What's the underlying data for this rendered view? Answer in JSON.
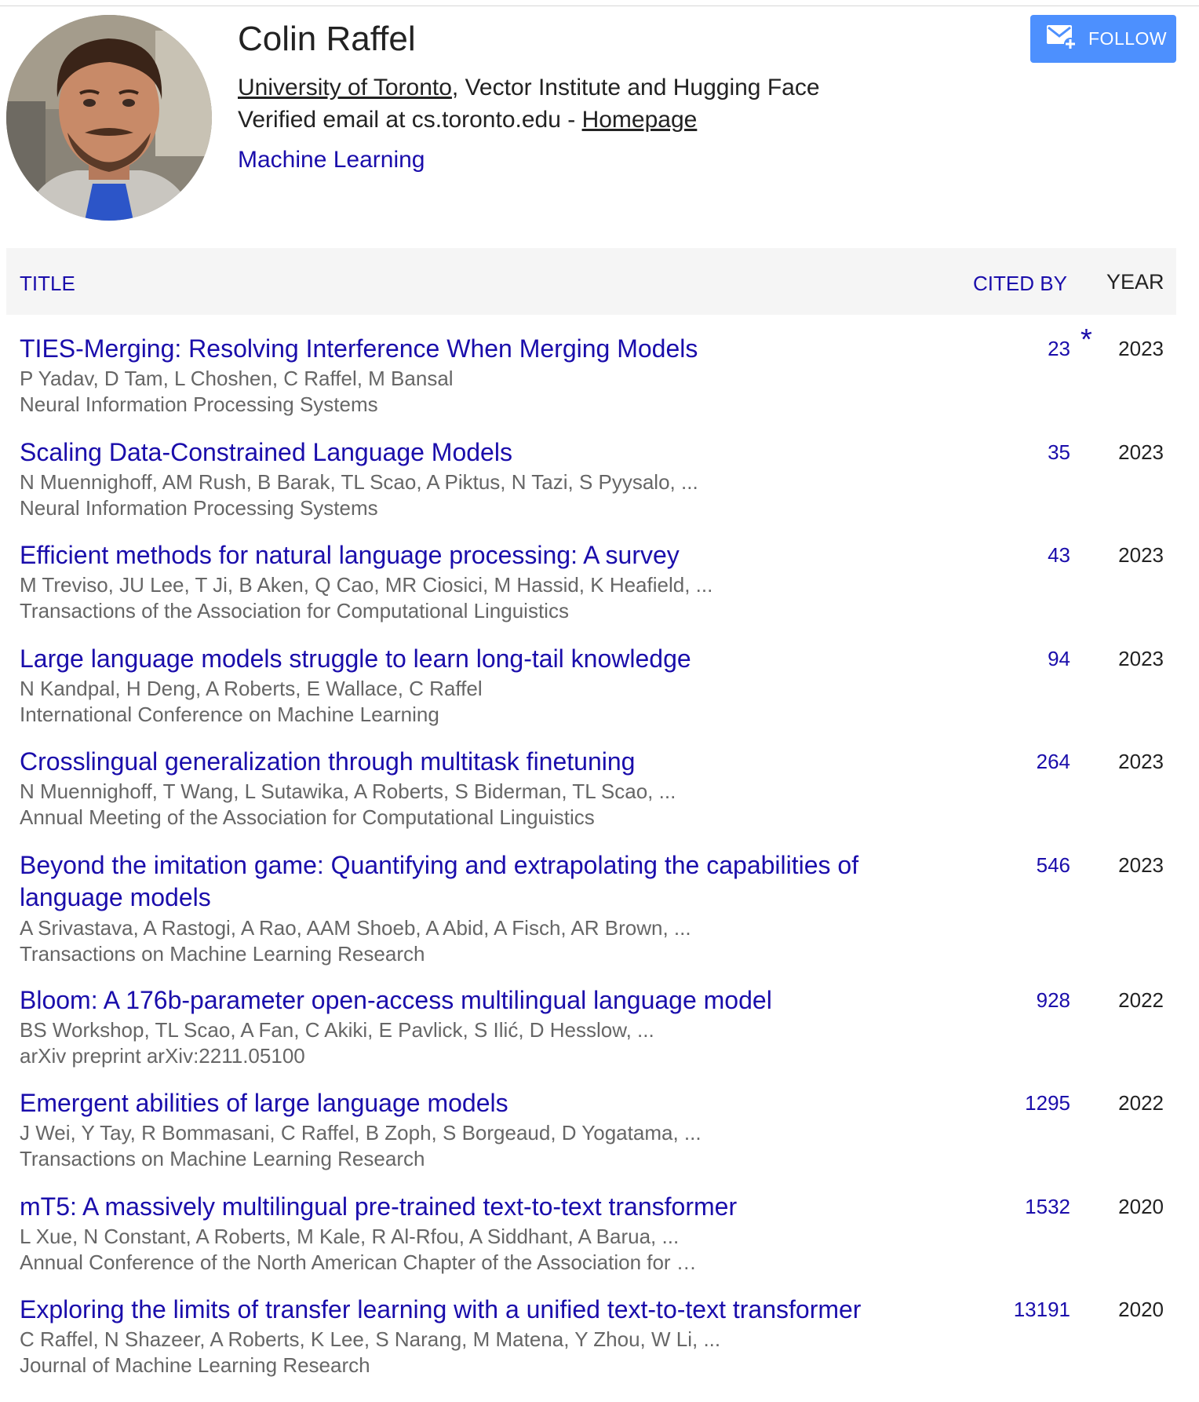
{
  "profile": {
    "name": "Colin Raffel",
    "affiliation_link": "University of Toronto",
    "affiliation_rest": ", Vector Institute and Hugging Face",
    "email_prefix": "Verified email at cs.toronto.edu - ",
    "homepage_label": "Homepage",
    "interest": "Machine Learning",
    "follow_label": "FOLLOW"
  },
  "table": {
    "col_title": "TITLE",
    "col_cited": "CITED BY",
    "col_year": "YEAR"
  },
  "publications": [
    {
      "title": "TIES-Merging: Resolving Interference When Merging Models",
      "authors": "P Yadav, D Tam, L Choshen, C Raffel, M Bansal",
      "venue": "Neural Information Processing Systems",
      "cited_by": "23",
      "star": "*",
      "year": "2023"
    },
    {
      "title": "Scaling Data-Constrained Language Models",
      "authors": "N Muennighoff, AM Rush, B Barak, TL Scao, A Piktus, N Tazi, S Pyysalo, ...",
      "venue": "Neural Information Processing Systems",
      "cited_by": "35",
      "year": "2023"
    },
    {
      "title": "Efficient methods for natural language processing: A survey",
      "authors": "M Treviso, JU Lee, T Ji, B Aken, Q Cao, MR Ciosici, M Hassid, K Heafield, ...",
      "venue": "Transactions of the Association for Computational Linguistics",
      "cited_by": "43",
      "year": "2023"
    },
    {
      "title": "Large language models struggle to learn long-tail knowledge",
      "authors": "N Kandpal, H Deng, A Roberts, E Wallace, C Raffel",
      "venue": "International Conference on Machine Learning",
      "cited_by": "94",
      "year": "2023"
    },
    {
      "title": "Crosslingual generalization through multitask finetuning",
      "authors": "N Muennighoff, T Wang, L Sutawika, A Roberts, S Biderman, TL Scao, ...",
      "venue": "Annual Meeting of the Association for Computational Linguistics",
      "cited_by": "264",
      "year": "2023"
    },
    {
      "title": "Beyond the imitation game: Quantifying and extrapolating the capabilities of language models",
      "authors": "A Srivastava, A Rastogi, A Rao, AAM Shoeb, A Abid, A Fisch, AR Brown, ...",
      "venue": "Transactions on Machine Learning Research",
      "cited_by": "546",
      "year": "2023"
    },
    {
      "title": "Bloom: A 176b-parameter open-access multilingual language model",
      "authors": "BS Workshop, TL Scao, A Fan, C Akiki, E Pavlick, S Ilić, D Hesslow, ...",
      "venue": "arXiv preprint arXiv:2211.05100",
      "cited_by": "928",
      "year": "2022"
    },
    {
      "title": "Emergent abilities of large language models",
      "authors": "J Wei, Y Tay, R Bommasani, C Raffel, B Zoph, S Borgeaud, D Yogatama, ...",
      "venue": "Transactions on Machine Learning Research",
      "cited_by": "1295",
      "year": "2022"
    },
    {
      "title": "mT5: A massively multilingual pre-trained text-to-text transformer",
      "authors": "L Xue, N Constant, A Roberts, M Kale, R Al-Rfou, A Siddhant, A Barua, ...",
      "venue": "Annual Conference of the North American Chapter of the Association for …",
      "cited_by": "1532",
      "year": "2020"
    },
    {
      "title": "Exploring the limits of transfer learning with a unified text-to-text transformer",
      "authors": "C Raffel, N Shazeer, A Roberts, K Lee, S Narang, M Matena, Y Zhou, W Li, ...",
      "venue": "Journal of Machine Learning Research",
      "cited_by": "13191",
      "year": "2020"
    }
  ],
  "colors": {
    "link": "#1a0dab",
    "meta": "#666666",
    "follow_button": "#4d90fe",
    "header_bg": "#f5f5f5"
  },
  "icons": {
    "follow": "mail-plus-icon",
    "avatar": "profile-photo"
  }
}
